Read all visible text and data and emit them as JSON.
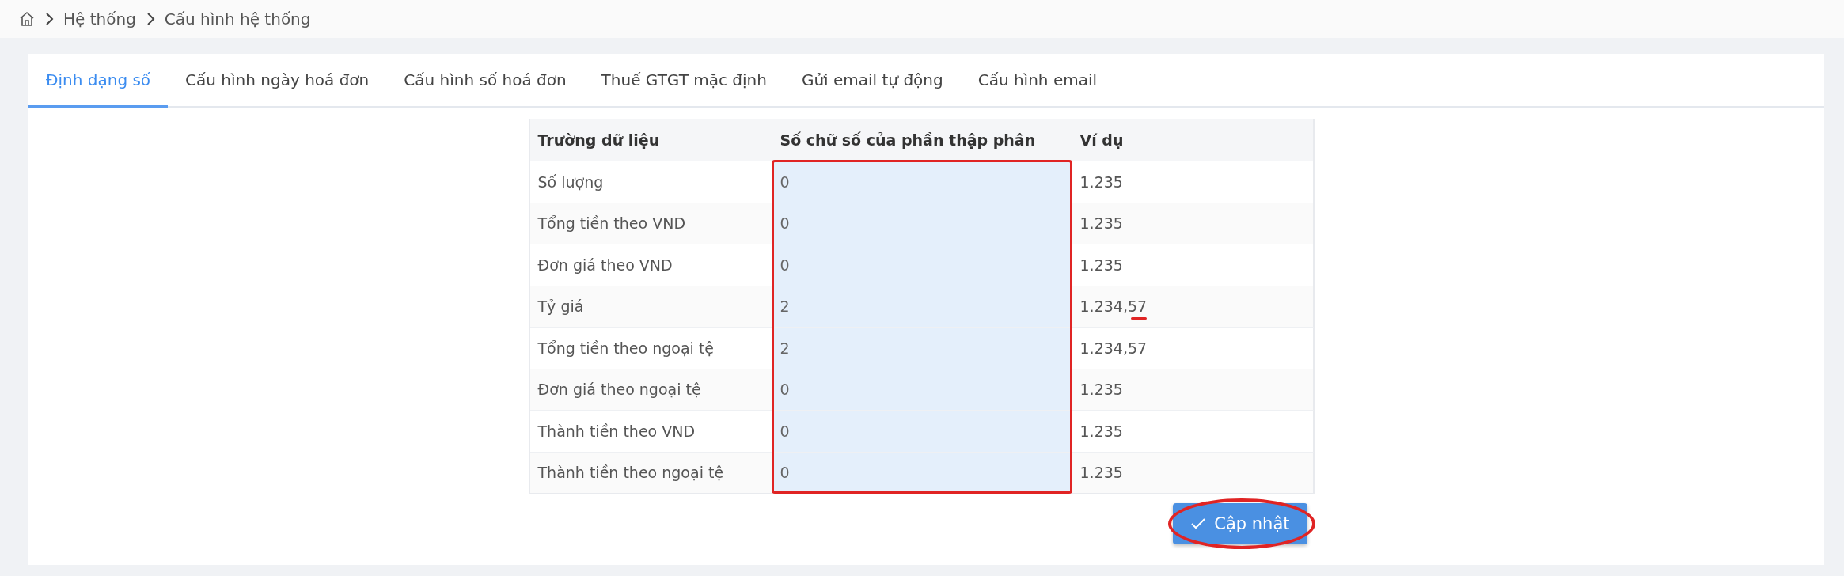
{
  "breadcrumb": [
    {
      "label": "Hệ thống"
    },
    {
      "label": "Cấu hình hệ thống"
    }
  ],
  "tabs": [
    {
      "label": "Định dạng số",
      "selected": true
    },
    {
      "label": "Cấu hình ngày hoá đơn",
      "selected": false
    },
    {
      "label": "Cấu hình số hoá đơn",
      "selected": false
    },
    {
      "label": "Thuế GTGT mặc định",
      "selected": false
    },
    {
      "label": "Gửi email tự động",
      "selected": false
    },
    {
      "label": "Cấu hình email",
      "selected": false
    }
  ],
  "table": {
    "columns": [
      "Trường dữ liệu",
      "Số chữ số của phần thập phân",
      "Ví dụ"
    ],
    "annotated_column": true,
    "rows": [
      {
        "field": "Số lượng",
        "digits": "0",
        "example": "1.235",
        "annotated": false
      },
      {
        "field": "Tổng tiền theo VND",
        "digits": "0",
        "example": "1.235",
        "annotated": false
      },
      {
        "field": "Đơn giá theo VND",
        "digits": "0",
        "example": "1.235",
        "annotated": false
      },
      {
        "field": "Tỷ giá",
        "digits": "2",
        "example": "1.234,57",
        "annotated": true
      },
      {
        "field": "Tổng tiền theo ngoại tệ",
        "digits": "2",
        "example": "1.234,57",
        "annotated": false
      },
      {
        "field": "Đơn giá theo ngoại tệ",
        "digits": "0",
        "example": "1.235",
        "annotated": false
      },
      {
        "field": "Thành tiền theo VND",
        "digits": "0",
        "example": "1.235",
        "annotated": false
      },
      {
        "field": "Thành tiền theo ngoại tệ",
        "digits": "0",
        "example": "1.235",
        "annotated": false
      }
    ]
  },
  "update_button": {
    "label": "Cập nhật",
    "annotated": true
  }
}
